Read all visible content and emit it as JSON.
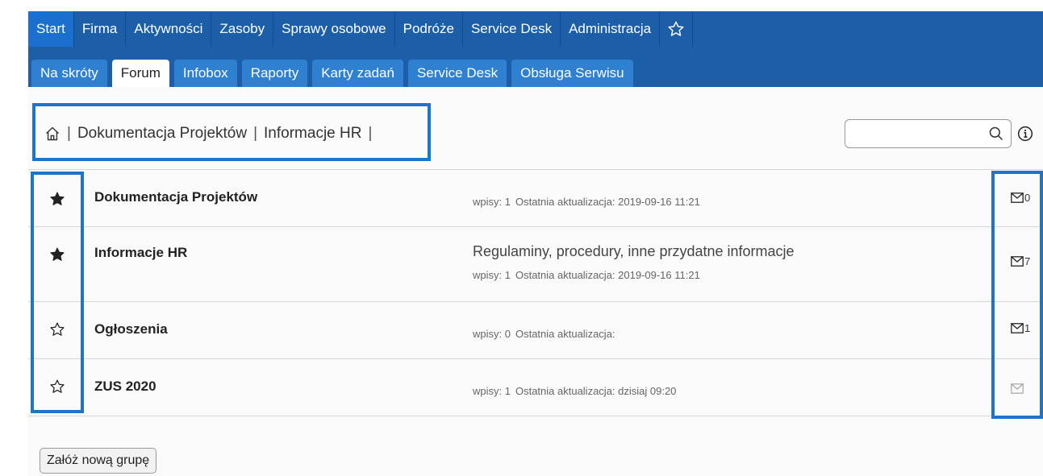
{
  "top_nav": {
    "items": [
      {
        "label": "Start",
        "active": true
      },
      {
        "label": "Firma"
      },
      {
        "label": "Aktywności"
      },
      {
        "label": "Zasoby"
      },
      {
        "label": "Sprawy osobowe"
      },
      {
        "label": "Podróże"
      },
      {
        "label": "Service Desk"
      },
      {
        "label": "Administracja"
      }
    ],
    "favorites_icon": "star-outline-icon"
  },
  "sub_nav": {
    "tabs": [
      {
        "label": "Na skróty"
      },
      {
        "label": "Forum",
        "active": true
      },
      {
        "label": "Infobox"
      },
      {
        "label": "Raporty"
      },
      {
        "label": "Karty zadań"
      },
      {
        "label": "Service Desk"
      },
      {
        "label": "Obsługa Serwisu"
      }
    ]
  },
  "breadcrumb": {
    "home_icon": "home-icon",
    "items": [
      "Dokumentacja Projektów",
      "Informacje HR"
    ]
  },
  "search": {
    "value": "",
    "placeholder": "",
    "icon": "search-icon"
  },
  "info_icon": "info-icon",
  "groups": [
    {
      "name": "Dokumentacja Projektów",
      "starred": true,
      "description": "",
      "entries_label": "wpisy: 1",
      "updated_label": "Ostatnia aktualizacja: 2019-09-16 11:21",
      "mail_count": "0"
    },
    {
      "name": "Informacje HR",
      "starred": true,
      "description": "Regulaminy, procedury, inne przydatne informacje",
      "entries_label": "wpisy: 1",
      "updated_label": "Ostatnia aktualizacja: 2019-09-16 11:21",
      "mail_count": "7"
    },
    {
      "name": "Ogłoszenia",
      "starred": false,
      "description": "",
      "entries_label": "wpisy: 0",
      "updated_label": "Ostatnia aktualizacja:",
      "mail_count": "1"
    },
    {
      "name": "ZUS 2020",
      "starred": false,
      "description": "",
      "entries_label": "wpisy: 1",
      "updated_label": "Ostatnia aktualizacja: dzisiaj 09:20",
      "mail_count": ""
    }
  ],
  "new_group_button": "Załóż nową grupę",
  "colors": {
    "nav_bg": "#1c5fa8",
    "tab_bg": "#2f80d1",
    "active_top": "#1b6fcf",
    "highlight": "#1d74c8"
  }
}
